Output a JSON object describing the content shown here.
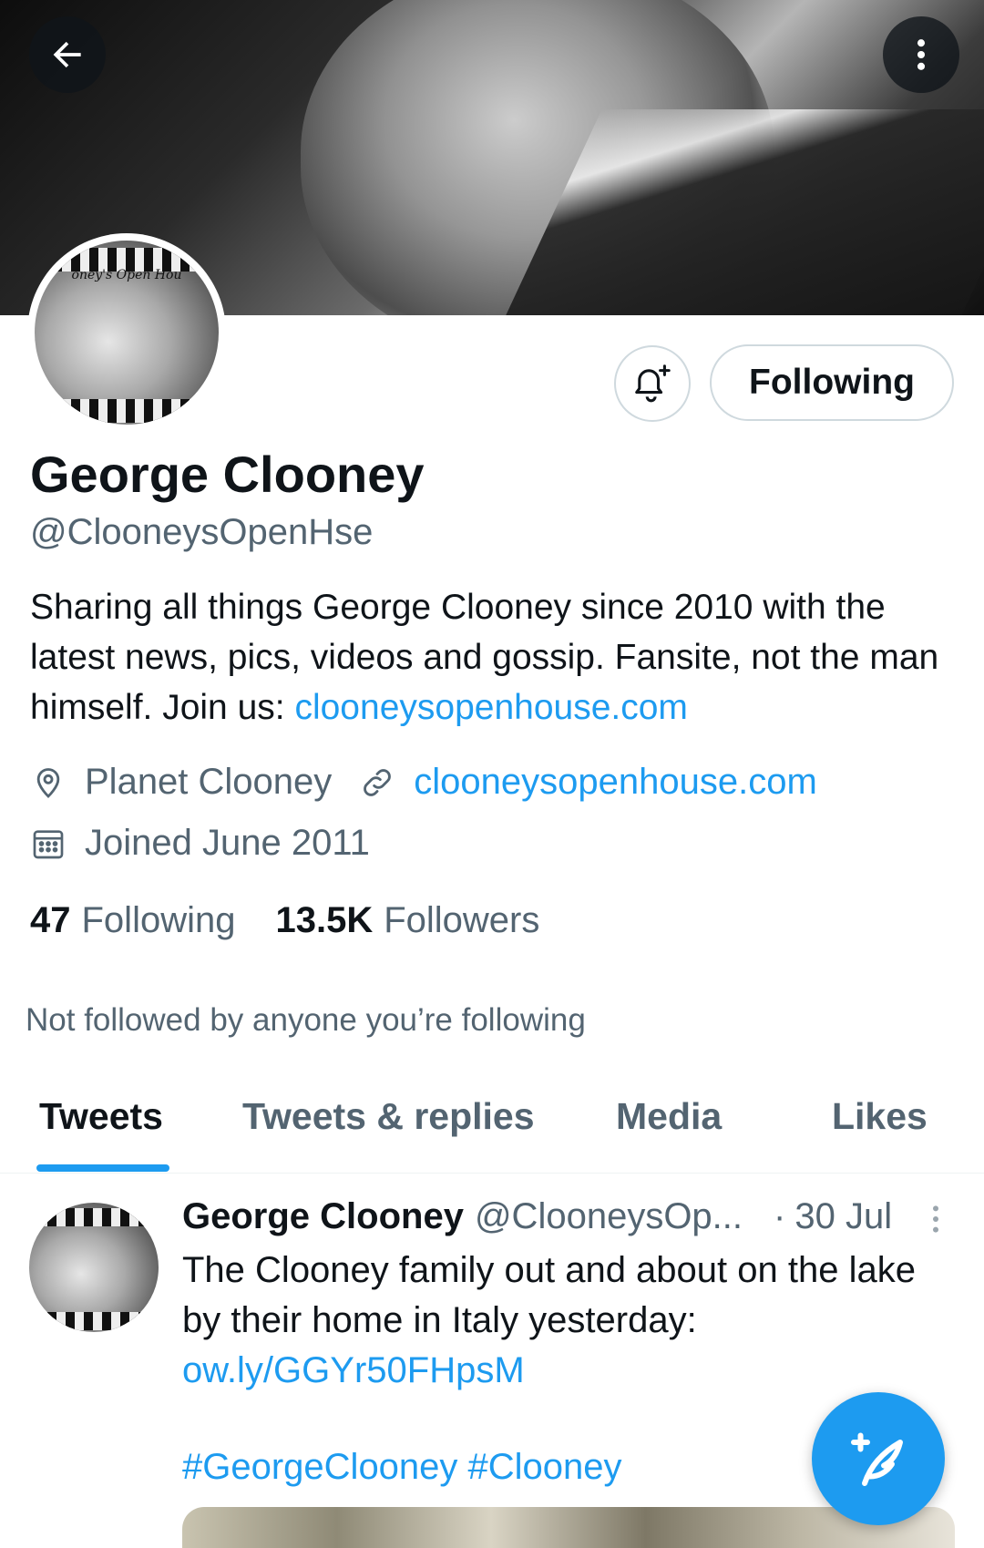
{
  "header": {
    "back_icon": "arrow-left-icon",
    "more_icon": "more-vertical-icon"
  },
  "profile": {
    "name": "George Clooney",
    "handle": "@ClooneysOpenHse",
    "avatar_caption": "oney's Open Hou",
    "bio_text": "Sharing all things George Clooney since 2010 with the latest news, pics, videos and gossip. Fansite, not the man himself. Join us: ",
    "bio_link": "clooneysopenhouse.com",
    "location": "Planet Clooney",
    "website": "clooneysopenhouse.com",
    "joined": "Joined June 2011",
    "following_count": "47",
    "following_label": "Following",
    "followers_count": "13.5K",
    "followers_label": "Followers",
    "not_followed_text": "Not followed by anyone you’re following"
  },
  "actions": {
    "notify_icon": "bell-plus-icon",
    "following_button": "Following"
  },
  "tabs": [
    {
      "label": "Tweets",
      "active": true
    },
    {
      "label": "Tweets & replies",
      "active": false
    },
    {
      "label": "Media",
      "active": false
    },
    {
      "label": "Likes",
      "active": false
    }
  ],
  "tweet": {
    "author_name": "George Clooney",
    "author_handle": "@ClooneysOp...",
    "date": "30 Jul",
    "dot": "·",
    "text": "The Clooney family out and about on the lake by their home in Italy yesterday: ",
    "link": "ow.ly/GGYr50FHpsM",
    "hashtags": "#GeorgeClooney #Clooney"
  },
  "fab": {
    "icon": "compose-tweet-icon"
  },
  "colors": {
    "accent": "#1d9bf0",
    "text_primary": "#0f1419",
    "text_secondary": "#536471",
    "border": "#cfd9de"
  }
}
